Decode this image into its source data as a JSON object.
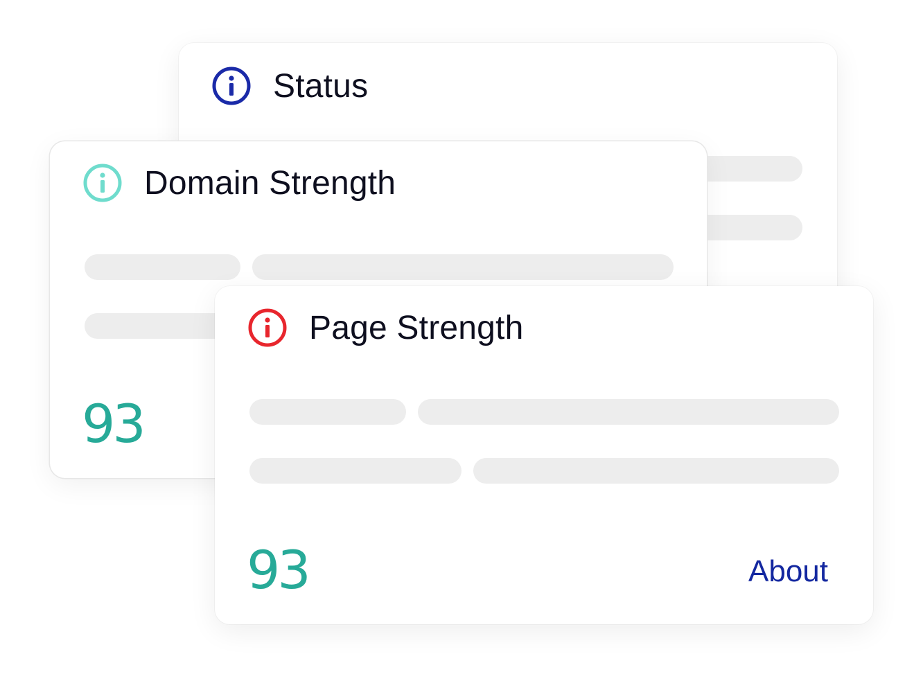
{
  "cards": {
    "status": {
      "title": "Status",
      "icon": "info-icon",
      "icon_color": "#1a2aa8"
    },
    "domain": {
      "title": "Domain Strength",
      "icon": "info-icon",
      "icon_color": "#6fdccd",
      "score": "93"
    },
    "page": {
      "title": "Page Strength",
      "icon": "info-icon",
      "icon_color": "#e8262d",
      "score": "93",
      "link_label": "About"
    }
  },
  "colors": {
    "score": "#27aa98",
    "link": "#1428a0",
    "placeholder_bar": "#ededed",
    "title_text": "#0e0f1f"
  }
}
